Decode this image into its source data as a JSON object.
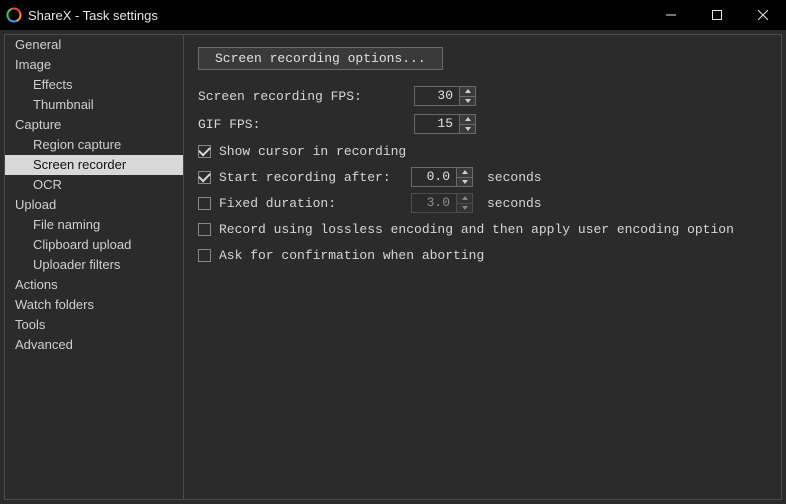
{
  "window": {
    "title": "ShareX - Task settings"
  },
  "sidebar": {
    "items": [
      {
        "label": "General",
        "child": false,
        "selected": false
      },
      {
        "label": "Image",
        "child": false,
        "selected": false
      },
      {
        "label": "Effects",
        "child": true,
        "selected": false
      },
      {
        "label": "Thumbnail",
        "child": true,
        "selected": false
      },
      {
        "label": "Capture",
        "child": false,
        "selected": false
      },
      {
        "label": "Region capture",
        "child": true,
        "selected": false
      },
      {
        "label": "Screen recorder",
        "child": true,
        "selected": true
      },
      {
        "label": "OCR",
        "child": true,
        "selected": false
      },
      {
        "label": "Upload",
        "child": false,
        "selected": false
      },
      {
        "label": "File naming",
        "child": true,
        "selected": false
      },
      {
        "label": "Clipboard upload",
        "child": true,
        "selected": false
      },
      {
        "label": "Uploader filters",
        "child": true,
        "selected": false
      },
      {
        "label": "Actions",
        "child": false,
        "selected": false
      },
      {
        "label": "Watch folders",
        "child": false,
        "selected": false
      },
      {
        "label": "Tools",
        "child": false,
        "selected": false
      },
      {
        "label": "Advanced",
        "child": false,
        "selected": false
      }
    ]
  },
  "panel": {
    "options_button": "Screen recording options...",
    "fps_label": "Screen recording FPS:",
    "fps_value": "30",
    "gif_fps_label": "GIF FPS:",
    "gif_fps_value": "15",
    "show_cursor": {
      "checked": true,
      "label": "Show cursor in recording"
    },
    "start_after": {
      "checked": true,
      "label": "Start recording after:",
      "value": "0.0",
      "unit": "seconds"
    },
    "fixed_dur": {
      "checked": false,
      "label": "Fixed duration:",
      "value": "3.0",
      "unit": "seconds"
    },
    "lossless": {
      "checked": false,
      "label": "Record using lossless encoding and then apply user encoding option"
    },
    "confirm": {
      "checked": false,
      "label": "Ask for confirmation when aborting"
    }
  }
}
